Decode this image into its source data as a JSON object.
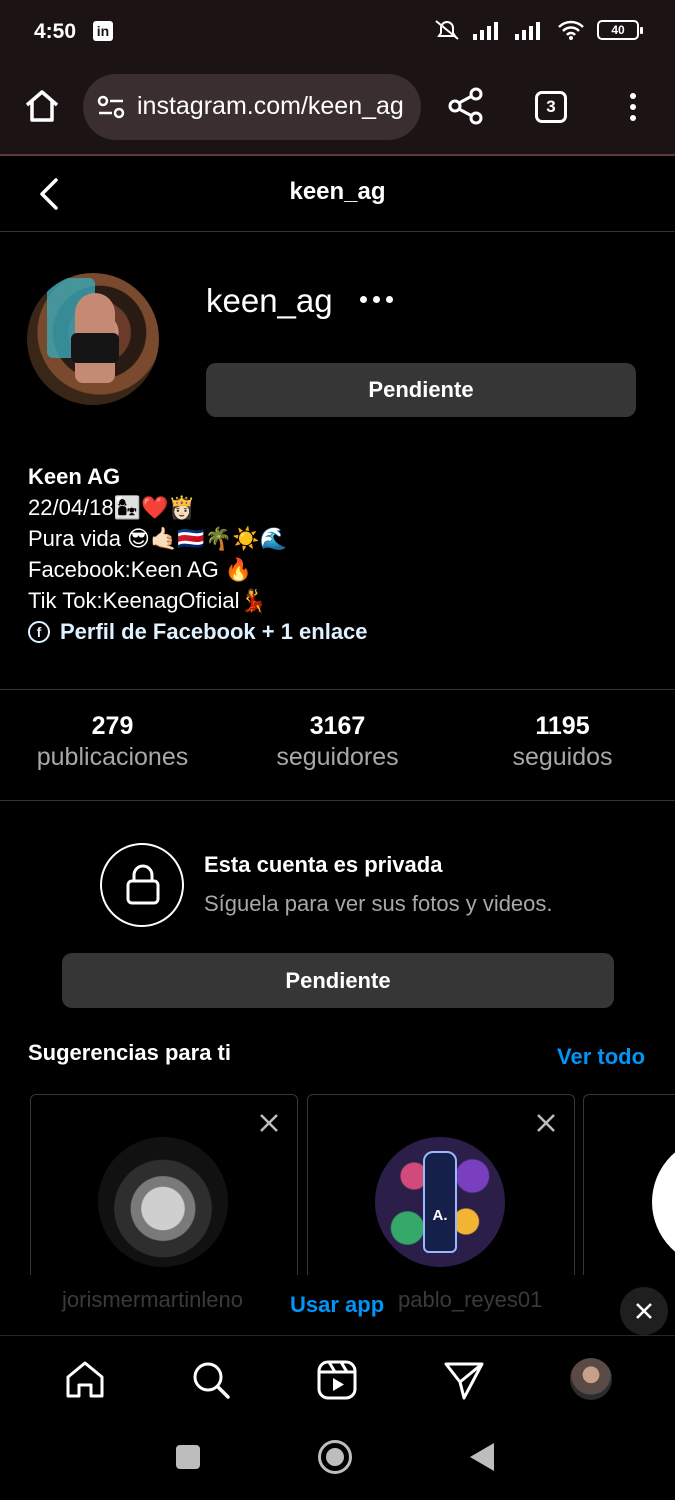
{
  "status_bar": {
    "time": "4:50",
    "linkedin_glyph": "in",
    "battery": "40"
  },
  "browser": {
    "url": "instagram.com/keen_ag",
    "tab_count": "3"
  },
  "header": {
    "title": "keen_ag"
  },
  "profile": {
    "username": "keen_ag",
    "follow_button": "Pendiente",
    "bio": {
      "name": "Keen AG",
      "lines": [
        "22/04/18👩‍👧❤️👸🏻",
        "Pura vida 😎🤙🏻🇨🇷🌴☀️🌊",
        "Facebook:Keen AG 🔥",
        "Tik Tok:KeenagOficial💃"
      ],
      "link_text": "Perfil de Facebook + 1 enlace",
      "link_icon": "facebook-icon"
    },
    "stats": [
      {
        "value": "279",
        "label": "publicaciones"
      },
      {
        "value": "3167",
        "label": "seguidores"
      },
      {
        "value": "1195",
        "label": "seguidos"
      }
    ]
  },
  "private": {
    "title": "Esta cuenta es privada",
    "subtitle": "Síguela para ver sus fotos y videos.",
    "button": "Pendiente"
  },
  "suggestions": {
    "title": "Sugerencias para ti",
    "see_all": "Ver todo",
    "cards": [
      {
        "name": "jorismermartinleno",
        "avatar_label": ""
      },
      {
        "name": "pablo_reyes01",
        "avatar_label": "A."
      }
    ]
  },
  "app_banner": {
    "label": "Usar app"
  },
  "colors": {
    "accent": "#0095f6",
    "button_bg": "#363636",
    "chrome_bg": "#1c1414"
  }
}
